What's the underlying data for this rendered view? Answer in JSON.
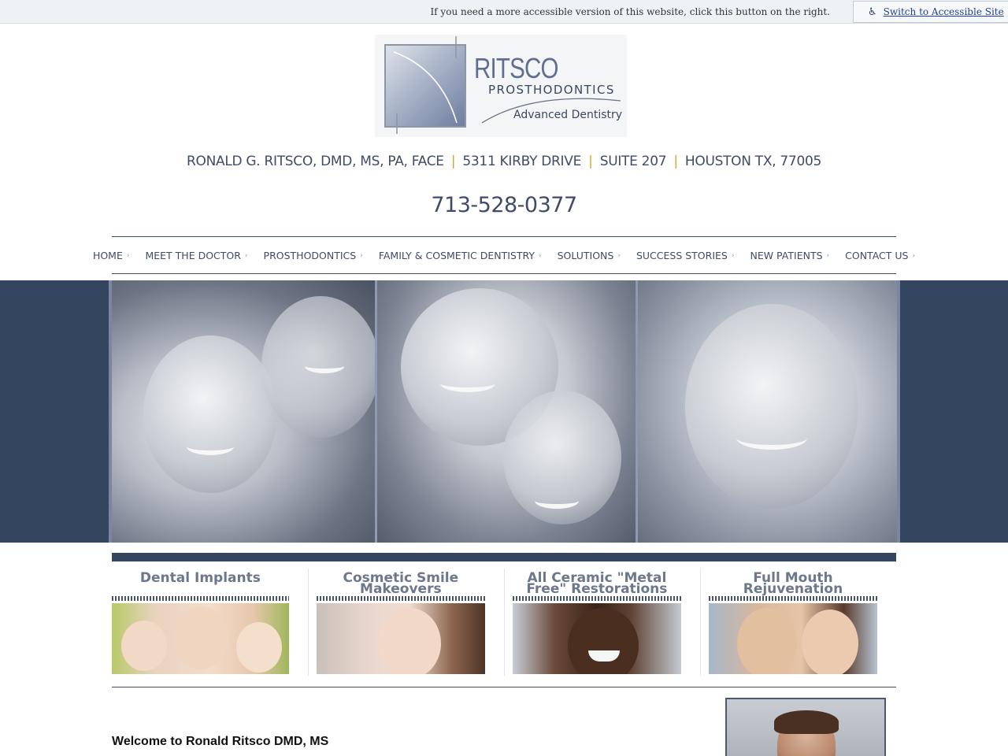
{
  "accessibility": {
    "message": "If you need a more accessible version of this website, click this button on the right.",
    "button_label": "Switch to Accessible Site",
    "icon": "wheelchair-icon"
  },
  "logo": {
    "name": "RITSCO",
    "subtitle": "PROSTHODONTICS",
    "tagline": "Advanced Dentistry"
  },
  "address": {
    "doctor": "RONALD G. RITSCO, DMD, MS, PA, FACE",
    "street": "5311 KIRBY DRIVE",
    "suite": "SUITE 207",
    "city": "HOUSTON TX, 77005",
    "separator": "|"
  },
  "phone": "713-528-0377",
  "nav": {
    "items": [
      {
        "label": "HOME"
      },
      {
        "label": "MEET THE DOCTOR"
      },
      {
        "label": "PROSTHODONTICS"
      },
      {
        "label": "FAMILY & COSMETIC DENTISTRY"
      },
      {
        "label": "SOLUTIONS"
      },
      {
        "label": "SUCCESS STORIES"
      },
      {
        "label": "NEW PATIENTS"
      },
      {
        "label": "CONTACT US"
      }
    ],
    "chevron": "›"
  },
  "features": [
    {
      "title": "Dental Implants"
    },
    {
      "title": "Cosmetic Smile Makeovers"
    },
    {
      "title": "All Ceramic \"Metal Free\" Restorations"
    },
    {
      "title": "Full Mouth Rejuvenation"
    }
  ],
  "welcome": "Welcome to Ronald Ritsco DMD, MS",
  "colors": {
    "brand_navy": "#34465f",
    "text": "#3f4b67",
    "accent_gold": "#d6a628",
    "link_blue": "#1c3f9a"
  }
}
